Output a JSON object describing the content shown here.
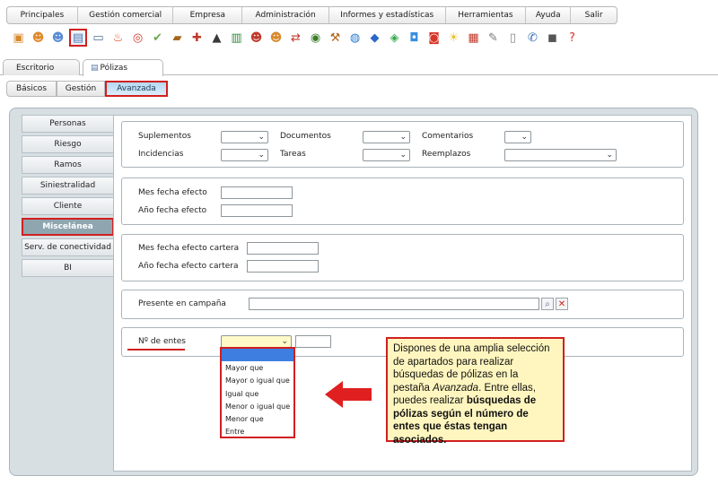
{
  "menu": {
    "items": [
      "Principales",
      "Gestión comercial",
      "Empresa",
      "Administración",
      "Informes y estadísticas",
      "Herramientas",
      "Ayuda",
      "Salir"
    ]
  },
  "toolbar": {
    "icons": [
      {
        "name": "box-icon",
        "glyph": "▣",
        "color": "#d88a2c"
      },
      {
        "name": "person-icon",
        "glyph": "☻",
        "color": "#e08a2a"
      },
      {
        "name": "person-blue-icon",
        "glyph": "☻",
        "color": "#5a8bd6"
      },
      {
        "name": "document-icon",
        "glyph": "▤",
        "color": "#4a77b5",
        "selected": true
      },
      {
        "name": "monitor-icon",
        "glyph": "▭",
        "color": "#4c6f9a"
      },
      {
        "name": "fire-icon",
        "glyph": "♨",
        "color": "#e0491f"
      },
      {
        "name": "target-icon",
        "glyph": "◎",
        "color": "#d8362a"
      },
      {
        "name": "check-icon",
        "glyph": "✔",
        "color": "#6aa84f"
      },
      {
        "name": "briefcase-icon",
        "glyph": "▰",
        "color": "#a8661c"
      },
      {
        "name": "first-aid-icon",
        "glyph": "✚",
        "color": "#c0392b"
      },
      {
        "name": "graduation-icon",
        "glyph": "▲",
        "color": "#3a3a3a"
      },
      {
        "name": "book-icon",
        "glyph": "▥",
        "color": "#2f8a3b"
      },
      {
        "name": "user-red-icon",
        "glyph": "☻",
        "color": "#c0392b"
      },
      {
        "name": "user-green-icon",
        "glyph": "☻",
        "color": "#d88a2c"
      },
      {
        "name": "transfer-icon",
        "glyph": "⇄",
        "color": "#c0392b"
      },
      {
        "name": "chart-icon",
        "glyph": "◉",
        "color": "#3a7d2a"
      },
      {
        "name": "tools-icon",
        "glyph": "⚒",
        "color": "#b5651d"
      },
      {
        "name": "globe-e-icon",
        "glyph": "◍",
        "color": "#2a7ad1"
      },
      {
        "name": "diamond-icon",
        "glyph": "◆",
        "color": "#2a67c9"
      },
      {
        "name": "arrows-icon",
        "glyph": "◈",
        "color": "#3aa84f"
      },
      {
        "name": "app-blue-icon",
        "glyph": "◘",
        "color": "#3a8ee0"
      },
      {
        "name": "app-red-icon",
        "glyph": "◙",
        "color": "#d8362a"
      },
      {
        "name": "bulb-icon",
        "glyph": "☀",
        "color": "#e8c22a"
      },
      {
        "name": "calendar-icon",
        "glyph": "▦",
        "color": "#c0392b"
      },
      {
        "name": "note-icon",
        "glyph": "✎",
        "color": "#777777"
      },
      {
        "name": "file-icon",
        "glyph": "▯",
        "color": "#888888"
      },
      {
        "name": "phone-icon",
        "glyph": "✆",
        "color": "#3a6fb5"
      },
      {
        "name": "camera-icon",
        "glyph": "◼",
        "color": "#555555"
      },
      {
        "name": "help-icon",
        "glyph": "?",
        "color": "#d8362a"
      }
    ]
  },
  "tabs": {
    "primary": [
      "Escritorio",
      "Pólizas"
    ],
    "secondary": [
      "Básicos",
      "Gestión",
      "Avanzada"
    ]
  },
  "sidebar": {
    "items": [
      "Personas",
      "Riesgo",
      "Ramos",
      "Siniestralidad",
      "Cliente",
      "Miscelánea",
      "Serv. de conectividad",
      "BI"
    ]
  },
  "form": {
    "suplementos": "Suplementos",
    "documentos": "Documentos",
    "comentarios": "Comentarios",
    "incidencias": "Incidencias",
    "tareas": "Tareas",
    "reemplazos": "Reemplazos",
    "mes_fecha_efecto": "Mes fecha efecto",
    "anio_fecha_efecto": "Año fecha efecto",
    "mes_fecha_efecto_cartera": "Mes fecha efecto cartera",
    "anio_fecha_efecto_cartera": "Año fecha efecto cartera",
    "presente_en_campania": "Presente en campaña",
    "num_entes": "Nº de entes"
  },
  "dropdown": {
    "options": [
      "",
      "Mayor que",
      "Mayor o igual que",
      "Igual que",
      "Menor o igual que",
      "Menor que",
      "Entre"
    ]
  },
  "callout": {
    "text_1": "Dispones de una amplia selección de apartados para realizar búsquedas de pólizas en la pestaña ",
    "text_italic": "Avanzada",
    "text_2": ". Entre ellas, puedes realizar ",
    "text_bold": "búsquedas de pólizas según el número de entes que éstas tengan asociados."
  },
  "colors": {
    "highlight_red": "#d21f1f",
    "callout_bg": "#fff6bf",
    "active_sidebar": "#8fa6b0"
  }
}
